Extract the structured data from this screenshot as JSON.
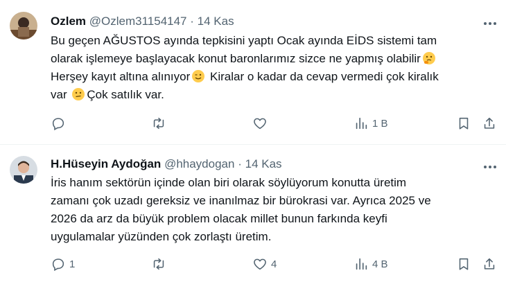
{
  "tweets": [
    {
      "name": "Ozlem",
      "handle": "@Ozlem31154147",
      "separator": "·",
      "date": "14 Kas",
      "lines": [
        "Bu geçen AĞUSTOS ayında tepkisini yaptı Ocak ayında EİDS sistemi tam",
        "olarak işlemeye başlayacak konut baronlarımız sizce ne yapmış olabilir",
        "Herşey kayıt altına alınıyor",
        " Kiralar o kadar da cevap vermedi çok kiralık",
        "var ",
        "Çok satılık var."
      ],
      "emojis": [
        "thinking-face",
        "winking-face",
        "confused-face"
      ],
      "actions": {
        "reply": "",
        "repost": "",
        "like": "",
        "views": "1 B"
      }
    },
    {
      "name": "H.Hüseyin Aydoğan",
      "handle": "@hhaydogan",
      "separator": "·",
      "date": "14 Kas",
      "lines": [
        "İris hanım sektörün içinde olan biri olarak söylüyorum konutta üretim",
        "zamanı çok uzadı gereksiz ve inanılmaz bir bürokrasi var. Ayrıca 2025 ve",
        "2026 da arz da büyük problem olacak millet bunun farkında keyfi",
        "uygulamalar yüzünden çok zorlaştı üretim."
      ],
      "actions": {
        "reply": "1",
        "repost": "",
        "like": "4",
        "views": "4 B"
      }
    }
  ],
  "colors": {
    "text": "#0f1419",
    "secondary": "#536471",
    "divider": "#eff3f4",
    "emoji": "#ffcc4d"
  }
}
